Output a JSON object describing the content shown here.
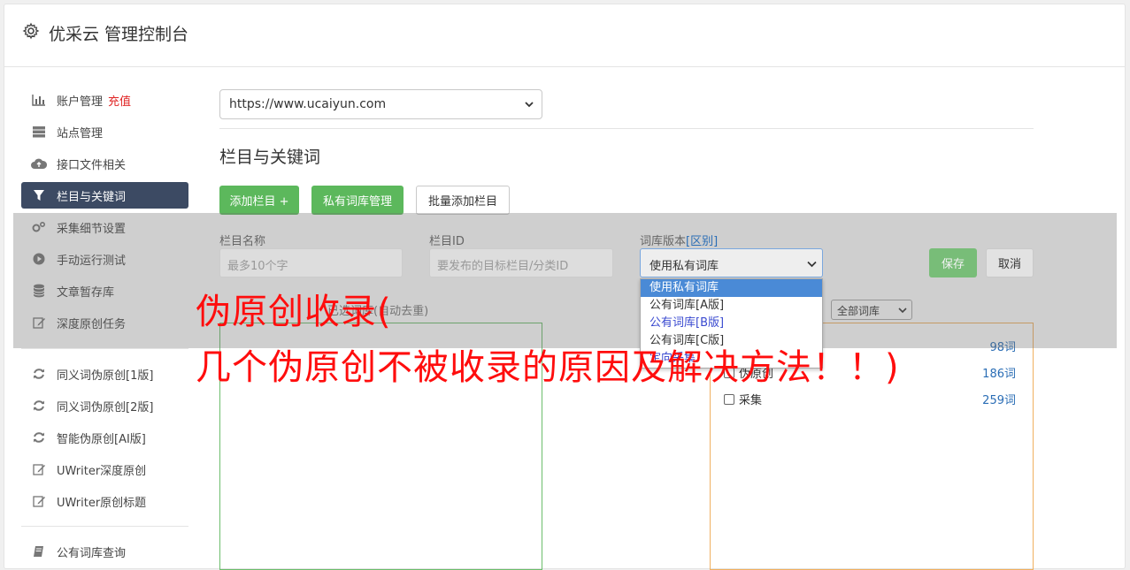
{
  "header": {
    "title": "优采云 管理控制台"
  },
  "sidebar": {
    "items": [
      {
        "label": "账户管理",
        "extra": "充值",
        "icon": "bar-chart-icon"
      },
      {
        "label": "站点管理",
        "icon": "server-icon"
      },
      {
        "label": "接口文件相关",
        "icon": "cloud-upload-icon"
      },
      {
        "label": "栏目与关键词",
        "icon": "filter-icon",
        "active": true
      },
      {
        "label": "采集细节设置",
        "icon": "gears-icon"
      },
      {
        "label": "手动运行测试",
        "icon": "play-circle-icon"
      },
      {
        "label": "文章暂存库",
        "icon": "database-icon"
      },
      {
        "label": "深度原创任务",
        "icon": "edit-icon"
      },
      {
        "label": "同义词伪原创[1版]",
        "icon": "refresh-icon"
      },
      {
        "label": "同义词伪原创[2版]",
        "icon": "refresh-icon"
      },
      {
        "label": "智能伪原创[AI版]",
        "icon": "refresh-icon"
      },
      {
        "label": "UWriter深度原创",
        "icon": "edit-icon"
      },
      {
        "label": "UWriter原创标题",
        "icon": "edit-icon"
      },
      {
        "label": "公有词库查询",
        "icon": "book-icon"
      }
    ]
  },
  "main": {
    "site_select": "https://www.ucaiyun.com",
    "section_title": "栏目与关键词",
    "buttons": {
      "add_column": "添加栏目 +",
      "private_lib": "私有词库管理",
      "batch_add": "批量添加栏目"
    },
    "form": {
      "name_label": "栏目名称",
      "name_placeholder": "最多10个字",
      "id_label": "栏目ID",
      "id_placeholder": "要发布的目标栏目/分类ID",
      "version_label": "词库版本",
      "version_link": "[区别]",
      "version_value": "使用私有词库",
      "save": "保存",
      "cancel": "取消"
    },
    "dropdown_options": [
      "使用私有词库",
      "公有词库[A版]",
      "公有词库[B版]",
      "公有词库[C版]",
      "定向采集"
    ],
    "selected_hint": "已选词库(自动去重)",
    "lib_filter": "全部词库",
    "libraries": [
      {
        "name": "",
        "count": "98词"
      },
      {
        "name": "伪原创",
        "count": "186词"
      },
      {
        "name": "采集",
        "count": "259词"
      }
    ]
  },
  "watermark": {
    "line1": "伪原创收录(",
    "line2": "几个伪原创不被收录的原因及解决方法！！)"
  },
  "colors": {
    "green": "#5cb85c",
    "nav_active": "#3c4a63",
    "red": "#ff0d0d",
    "link": "#2a6db5"
  }
}
